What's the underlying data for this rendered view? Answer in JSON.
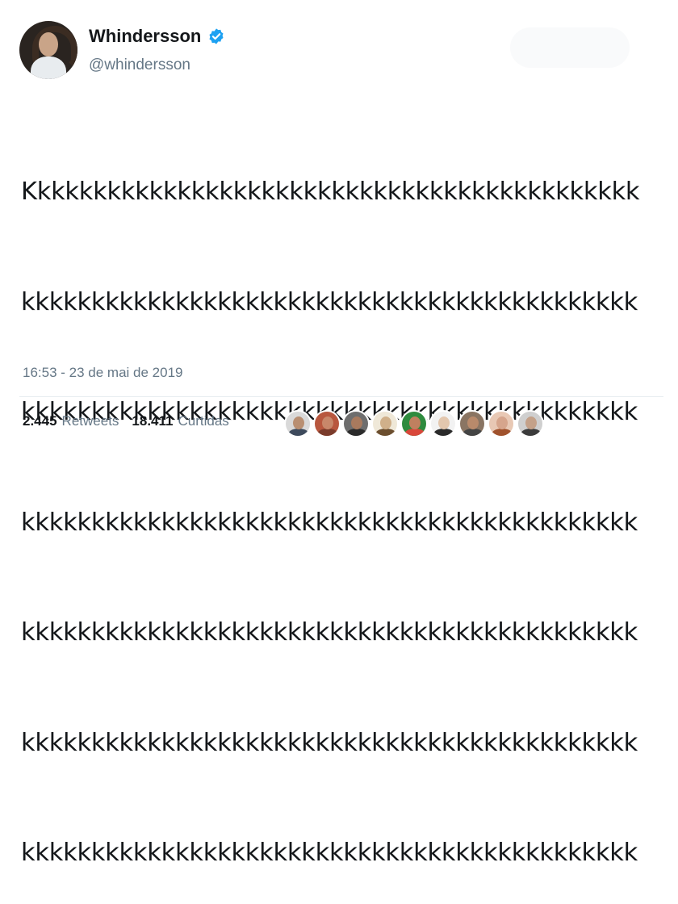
{
  "user": {
    "display_name": "Whindersson",
    "handle": "@whindersson"
  },
  "tweet": {
    "lines": [
      "Kkkkkkkkkkkkkkkkkkkkkkkkkkkkkkkkkkkkkkkkkkkk",
      "kkkkkkkkkkkkkkkkkkkkkkkkkkkkkkkkkkkkkkkkkkkk",
      "kkkkkkkkkkkkkkkkkkkkkkkkkkkkkkkkkkkkkkkkkkkk",
      "kkkkkkkkkkkkkkkkkkkkkkkkkkkkkkkkkkkkkkkkkkkk",
      "kkkkkkkkkkkkkkkkkkkkkkkkkkkkkkkkkkkkkkkkkkkk",
      "kkkkkkkkkkkkkkkkkkkkkkkkkkkkkkkkkkkkkkkkkkkk",
      "kkkkkkkkkkkkkkkkkkkkkkkkkkkkkkkkkkkkkkkkkkkk"
    ],
    "timestamp": "16:53 - 23 de mai de 2019"
  },
  "stats": {
    "retweets_count": "2.445",
    "retweets_label": "Retweets",
    "likes_count": "18.411",
    "likes_label": "Curtidas"
  },
  "likers": [
    {
      "face": "#b98f72",
      "body": "#3d4a5c",
      "bg": "#d9d9d9"
    },
    {
      "face": "#c8876a",
      "body": "#7a3b2b",
      "bg": "#b8573e"
    },
    {
      "face": "#a87a5e",
      "body": "#2b2b2b",
      "bg": "#6e6e6e"
    },
    {
      "face": "#d0b08a",
      "body": "#6b4e2e",
      "bg": "#efe8d8"
    },
    {
      "face": "#c0805f",
      "body": "#d9473a",
      "bg": "#2e8b3e"
    },
    {
      "face": "#e3c7ae",
      "body": "#2a2a2a",
      "bg": "#f2f2f2"
    },
    {
      "face": "#b98a6b",
      "body": "#444444",
      "bg": "#8a7563"
    },
    {
      "face": "#d6a58c",
      "body": "#a0522d",
      "bg": "#e8c8b4"
    },
    {
      "face": "#c4a189",
      "body": "#3b3b3b",
      "bg": "#cfcfcf"
    }
  ],
  "colors": {
    "verified": "#1da1f2",
    "secondary_text": "#657786"
  }
}
